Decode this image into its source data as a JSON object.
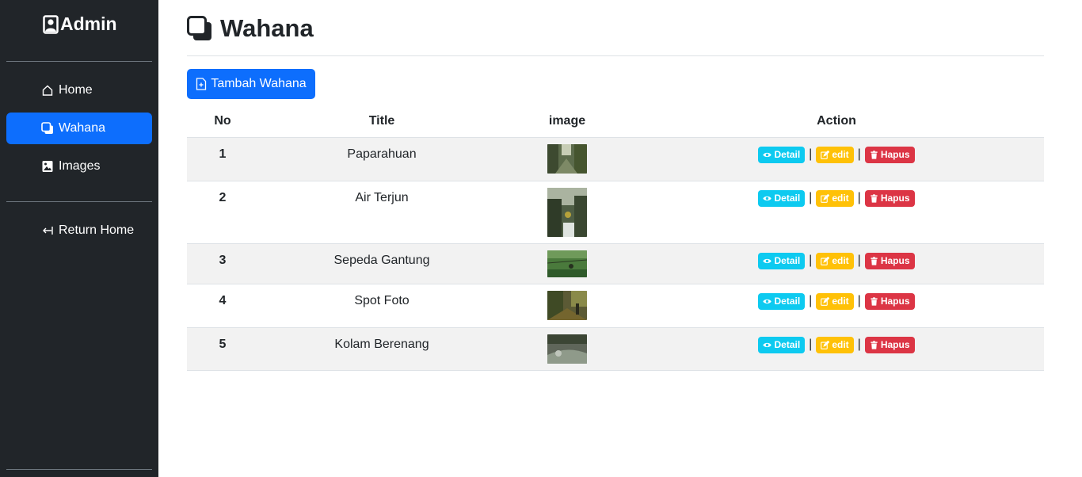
{
  "sidebar": {
    "brand": "Admin",
    "items": [
      {
        "label": "Home",
        "icon": "house-icon",
        "active": false
      },
      {
        "label": "Wahana",
        "icon": "layers-icon",
        "active": true
      },
      {
        "label": "Images",
        "icon": "image-icon",
        "active": false
      }
    ],
    "return_label": "Return Home"
  },
  "main": {
    "title": "Wahana",
    "add_button_label": "Tambah Wahana",
    "table": {
      "headers": [
        "No",
        "Title",
        "image",
        "Action"
      ],
      "rows": [
        {
          "no": "1",
          "title": "Paparahuan",
          "image": "photo-paparahuan"
        },
        {
          "no": "2",
          "title": "Air Terjun",
          "image": "photo-air-terjun"
        },
        {
          "no": "3",
          "title": "Sepeda Gantung",
          "image": "photo-sepeda-gantung"
        },
        {
          "no": "4",
          "title": "Spot Foto",
          "image": "photo-spot-foto"
        },
        {
          "no": "5",
          "title": "Kolam Berenang",
          "image": "photo-kolam-berenang"
        }
      ],
      "actions": {
        "detail": "Detail",
        "edit": "edit",
        "delete": "Hapus",
        "separator": "|"
      }
    }
  },
  "colors": {
    "sidebar_bg": "#212529",
    "primary": "#0d6efd",
    "info": "#0dcaf0",
    "warning": "#ffc107",
    "danger": "#dc3545"
  }
}
